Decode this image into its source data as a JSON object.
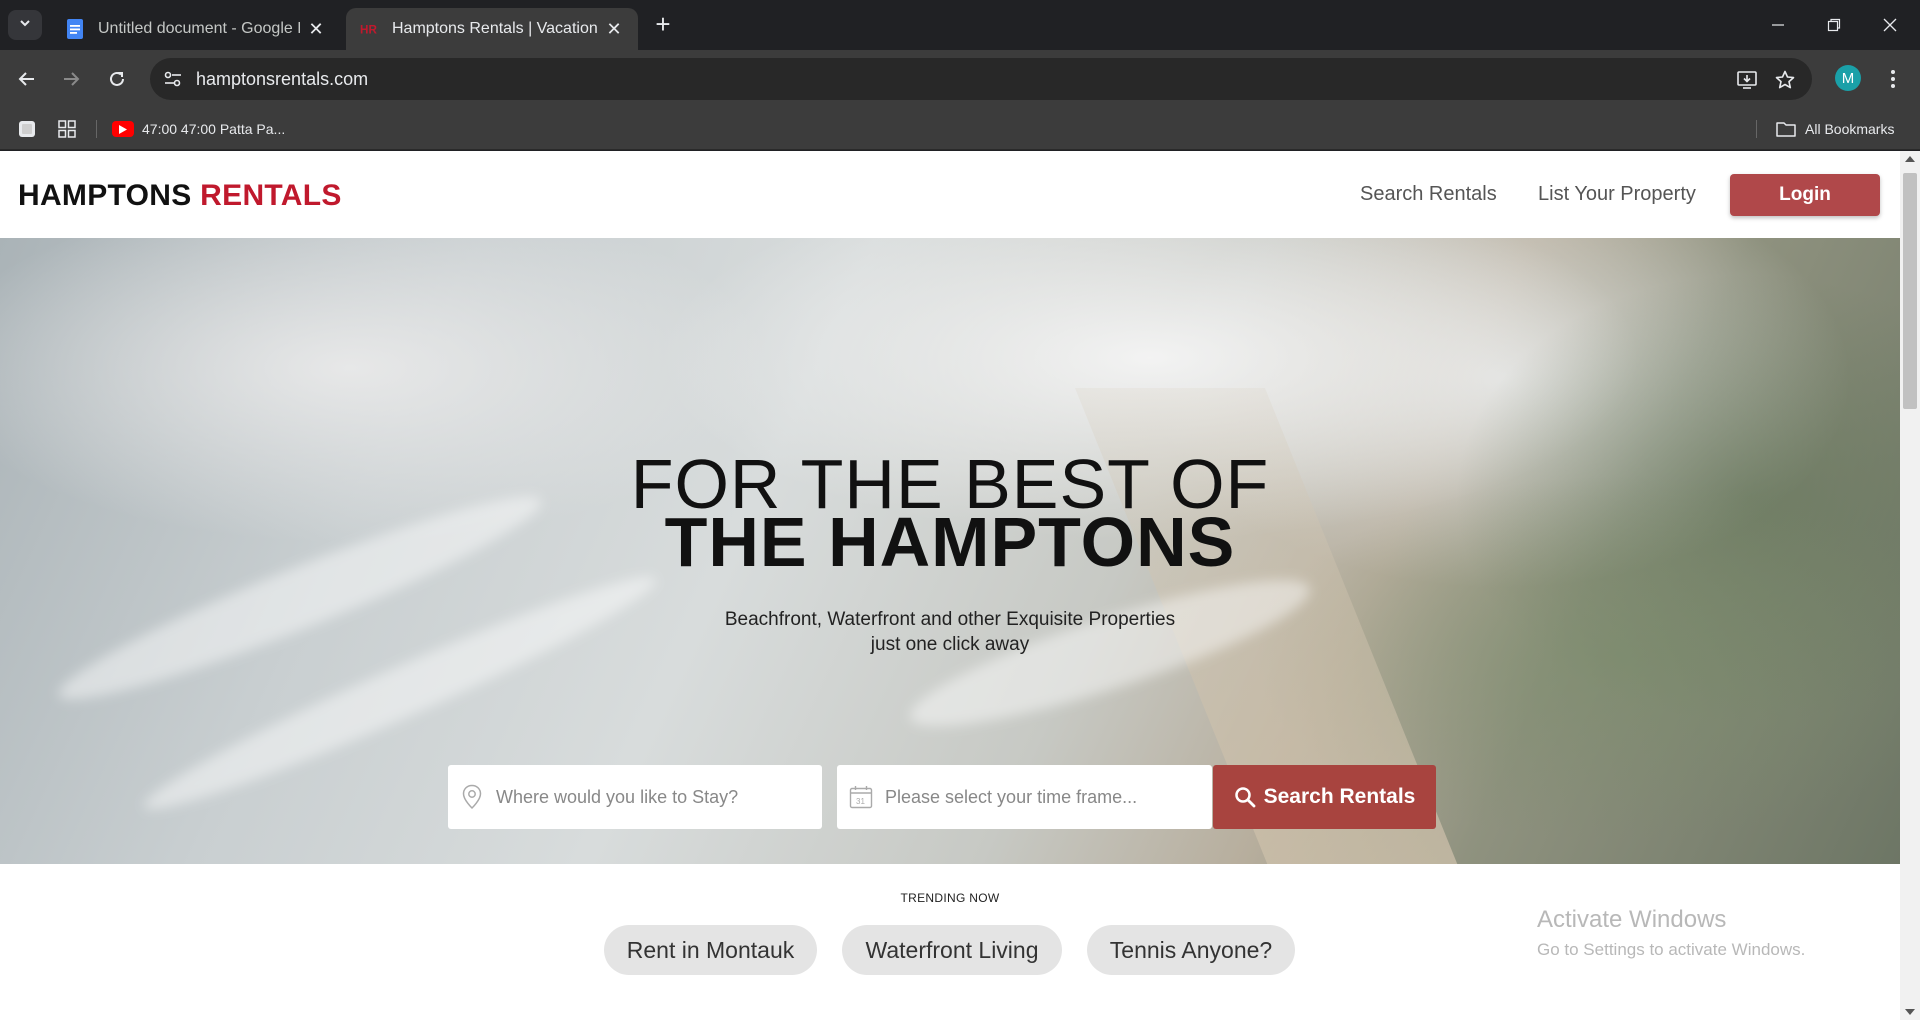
{
  "browser": {
    "tabs": [
      {
        "title": "Untitled document - Google Docs",
        "active": false
      },
      {
        "title": "Hamptons Rentals | Vacation Rentals",
        "active": true
      }
    ],
    "url": "hamptonsrentals.com",
    "profile_initial": "M",
    "bookmarks": {
      "item_label": "47:00 47:00 Patta Pa...",
      "all_bookmarks_label": "All Bookmarks"
    }
  },
  "site": {
    "logo": {
      "part1": "HAMPTONS",
      "part2": "RENTALS"
    },
    "nav": {
      "search_rentals": "Search Rentals",
      "list_property": "List Your Property",
      "login": "Login"
    },
    "hero": {
      "title_line1": "FOR THE BEST OF",
      "title_line2": "THE HAMPTONS",
      "subtitle_line1": "Beachfront, Waterfront and other Exquisite Properties",
      "subtitle_line2": "just one click away"
    },
    "search": {
      "location_placeholder": "Where would you like to Stay?",
      "date_placeholder": "Please select your time frame...",
      "calendar_day": "31",
      "button_label": "Search Rentals"
    },
    "trending": {
      "label": "TRENDING NOW",
      "pills": [
        "Rent in Montauk",
        "Waterfront Living",
        "Tennis Anyone?"
      ]
    }
  },
  "os_overlay": {
    "activate_title": "Activate Windows",
    "activate_sub": "Go to Settings to activate Windows."
  },
  "colors": {
    "brand_red": "#c0192d",
    "button_red": "#b0484a",
    "search_button": "#a8443f",
    "chrome_dark": "#202124",
    "chrome_toolbar": "#3c3c3c"
  }
}
